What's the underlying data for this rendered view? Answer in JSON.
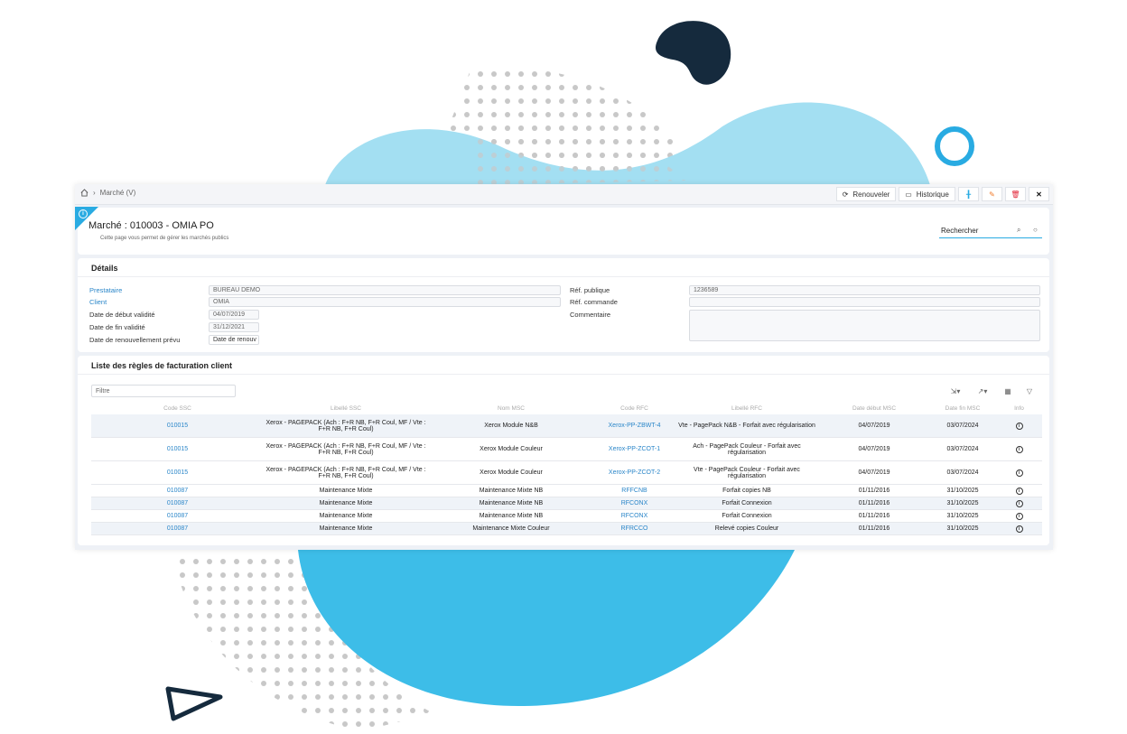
{
  "breadcrumb": {
    "current": "Marché (V)"
  },
  "toolbar": {
    "renew_label": "Renouveler",
    "history_label": "Historique"
  },
  "header": {
    "title": "Marché : 010003 - OMIA PO",
    "subtitle": "Cette page vous permet de gérer les marchés publics",
    "search_label": "Rechercher"
  },
  "details": {
    "section_title": "Détails",
    "left": [
      {
        "label": "Prestataire",
        "value": "BUREAU DEMO"
      },
      {
        "label": "Client",
        "value": "OMIA"
      },
      {
        "label": "Date de début validité",
        "value": "04/07/2019"
      },
      {
        "label": "Date de fin validité",
        "value": "31/12/2021"
      },
      {
        "label": "Date de renouvellement prévu",
        "value": "Date de renouv"
      }
    ],
    "right": [
      {
        "label": "Réf. publique",
        "value": "1236589"
      },
      {
        "label": "Réf. commande",
        "value": ""
      },
      {
        "label": "Commentaire",
        "value": ""
      }
    ]
  },
  "list": {
    "section_title": "Liste des règles de facturation client",
    "filter_placeholder": "Filtre",
    "columns": [
      "Code SSC",
      "Libellé SSC",
      "Nom MSC",
      "Code RFC",
      "Libellé RFC",
      "Date début MSC",
      "Date fin MSC",
      "Info"
    ],
    "rows": [
      {
        "code_ssc": "010015",
        "libelle_ssc": "Xerox - PAGEPACK (Ach : F+R NB, F+R Coul, MF / Vte : F+R NB, F+R Coul)",
        "nom_msc": "Xerox Module N&B",
        "code_rfc": "Xerox-PP-ZBWT-4",
        "libelle_rfc": "Vte - PagePack N&B - Forfait avec régularisation",
        "date_debut": "04/07/2019",
        "date_fin": "03/07/2024",
        "info": "i"
      },
      {
        "code_ssc": "010015",
        "libelle_ssc": "Xerox - PAGEPACK (Ach : F+R NB, F+R Coul, MF / Vte : F+R NB, F+R Coul)",
        "nom_msc": "Xerox Module Couleur",
        "code_rfc": "Xerox-PP-ZCOT-1",
        "libelle_rfc": "Ach - PagePack Couleur - Forfait avec régularisation",
        "date_debut": "04/07/2019",
        "date_fin": "03/07/2024",
        "info": "i"
      },
      {
        "code_ssc": "010015",
        "libelle_ssc": "Xerox - PAGEPACK (Ach : F+R NB, F+R Coul, MF / Vte : F+R NB, F+R Coul)",
        "nom_msc": "Xerox Module Couleur",
        "code_rfc": "Xerox-PP-ZCOT-2",
        "libelle_rfc": "Vte - PagePack Couleur - Forfait avec régularisation",
        "date_debut": "04/07/2019",
        "date_fin": "03/07/2024",
        "info": "i"
      },
      {
        "code_ssc": "010087",
        "libelle_ssc": "Maintenance Mixte",
        "nom_msc": "Maintenance Mixte NB",
        "code_rfc": "RFFCNB",
        "libelle_rfc": "Forfait copies NB",
        "date_debut": "01/11/2016",
        "date_fin": "31/10/2025",
        "info": "i"
      },
      {
        "code_ssc": "010087",
        "libelle_ssc": "Maintenance Mixte",
        "nom_msc": "Maintenance Mixte NB",
        "code_rfc": "RFCONX",
        "libelle_rfc": "Forfait Connexion",
        "date_debut": "01/11/2016",
        "date_fin": "31/10/2025",
        "info": "i"
      },
      {
        "code_ssc": "010087",
        "libelle_ssc": "Maintenance Mixte",
        "nom_msc": "Maintenance Mixte NB",
        "code_rfc": "RFCONX",
        "libelle_rfc": "Forfait Connexion",
        "date_debut": "01/11/2016",
        "date_fin": "31/10/2025",
        "info": "i"
      },
      {
        "code_ssc": "010087",
        "libelle_ssc": "Maintenance Mixte",
        "nom_msc": "Maintenance Mixte Couleur",
        "code_rfc": "RFRCCO",
        "libelle_rfc": "Relevé copies Couleur",
        "date_debut": "01/11/2016",
        "date_fin": "31/10/2025",
        "info": "i"
      }
    ]
  },
  "colors": {
    "accent": "#29abe2",
    "link": "#2a86c9",
    "blob_light": "#a3dff2",
    "blob": "#3dbde8",
    "dark": "#152a3d"
  },
  "icons": [
    "home-icon",
    "refresh-icon",
    "history-icon",
    "pin-icon",
    "pencil-icon",
    "trash-icon",
    "close-icon",
    "search-icon",
    "settings-icon",
    "export-icon",
    "columns-icon",
    "filter-icon",
    "info-icon"
  ]
}
